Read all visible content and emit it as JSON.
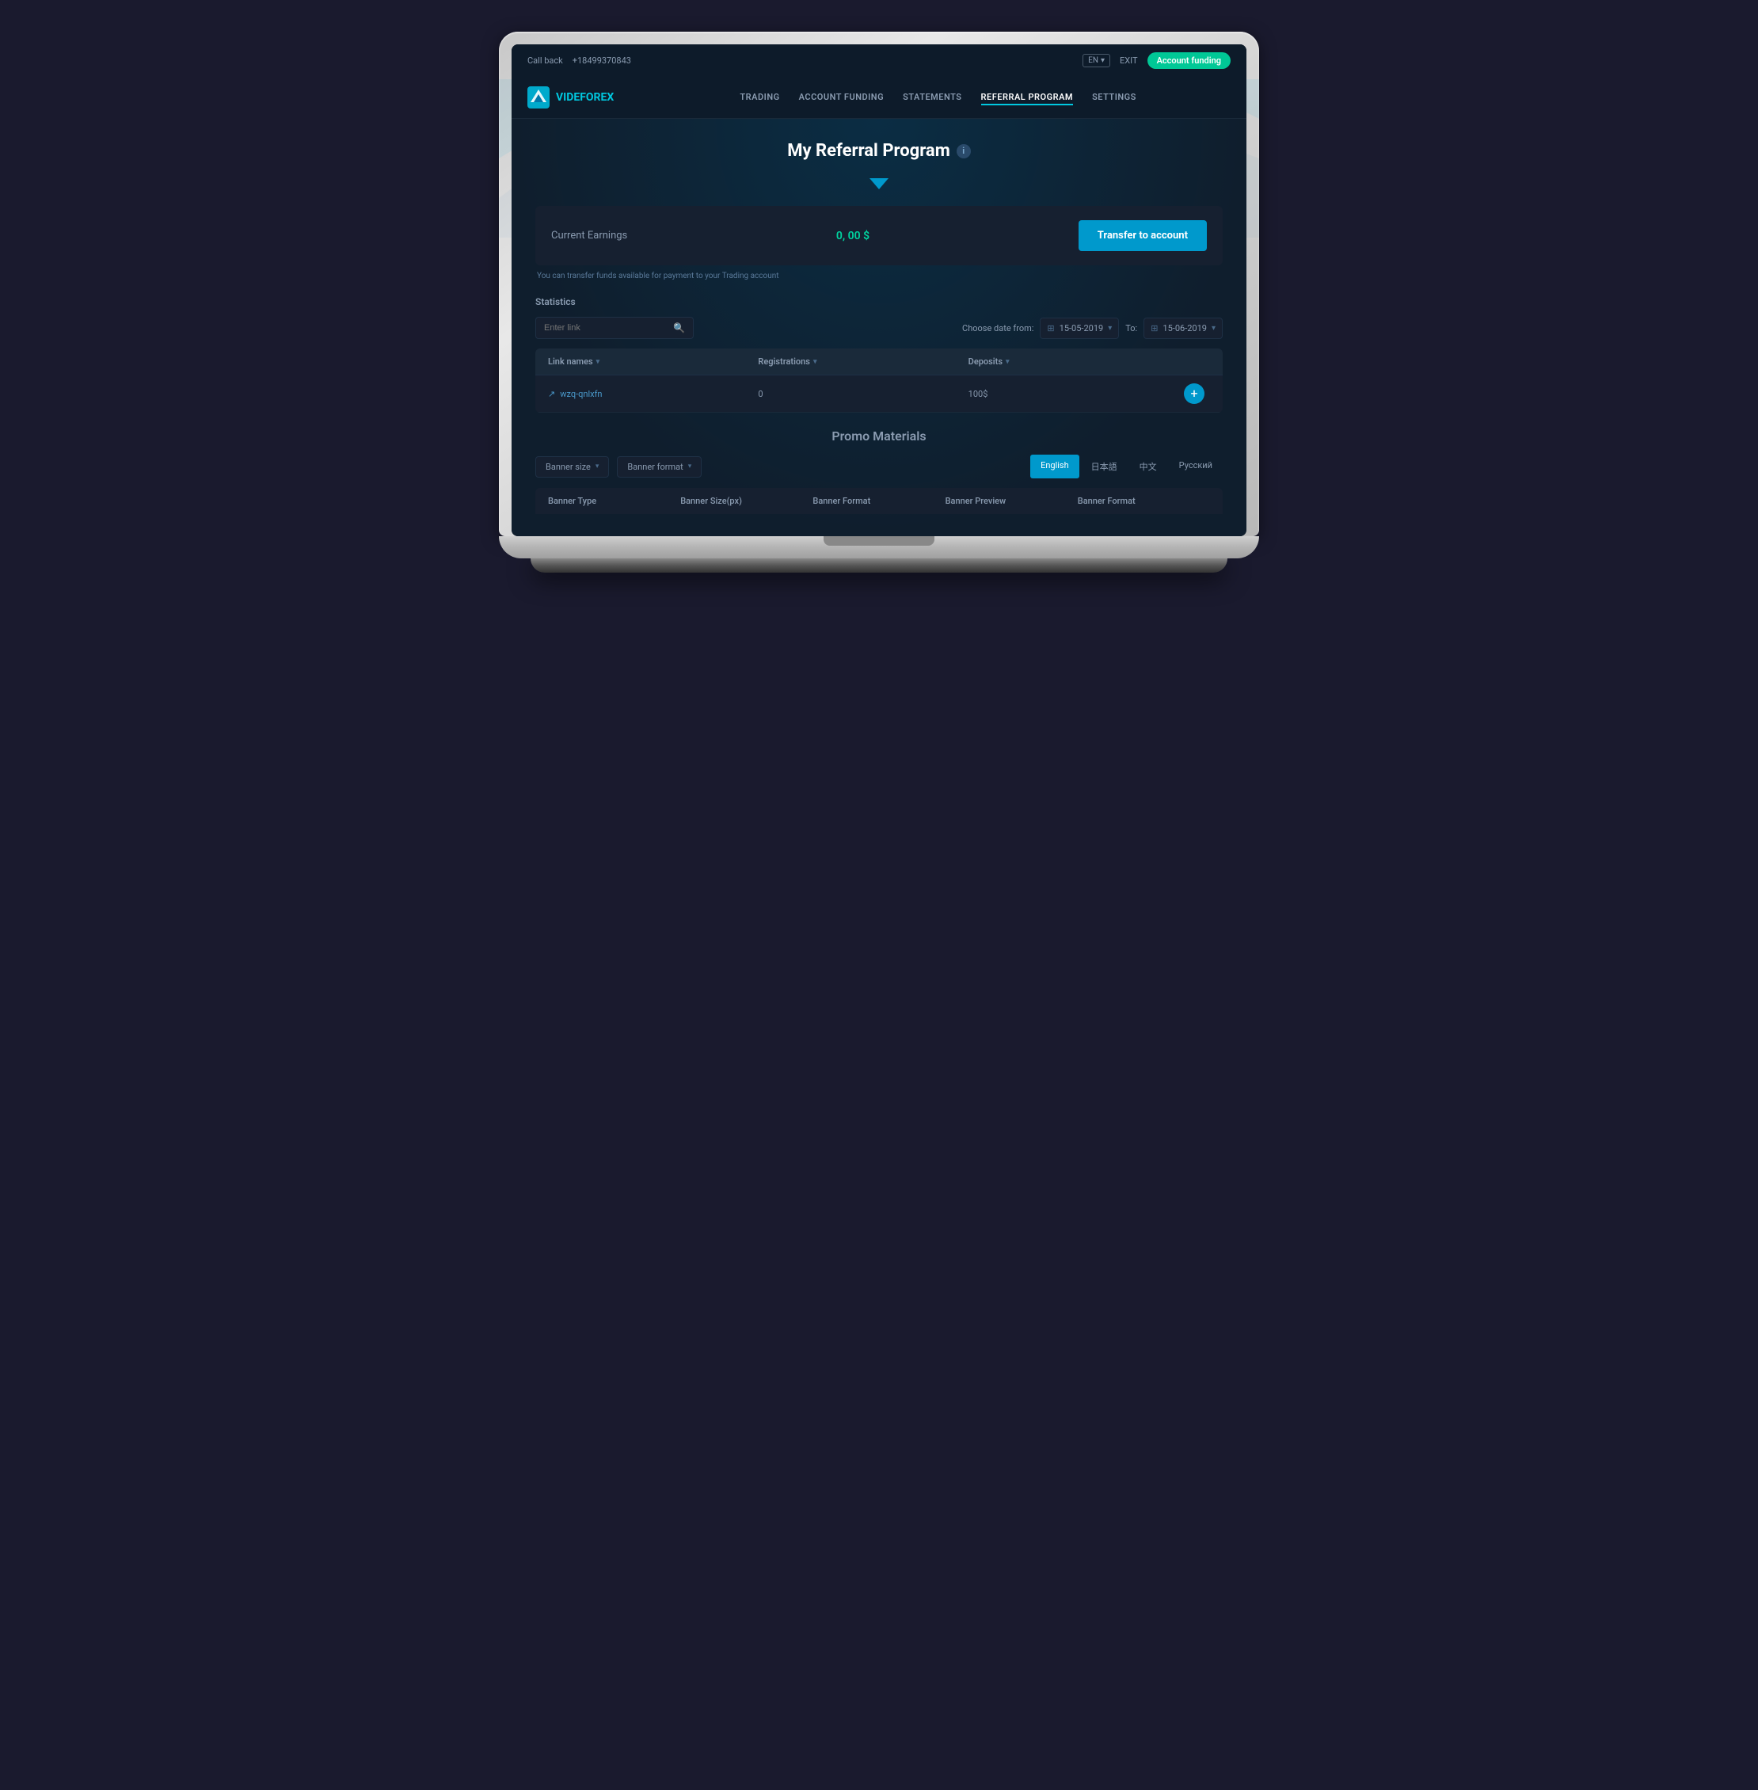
{
  "topbar": {
    "call_back_label": "Call back",
    "phone": "+18499370843",
    "lang": "EN",
    "lang_chevron": "▾",
    "exit_label": "EXIT",
    "account_funding_btn": "Account funding"
  },
  "nav": {
    "logo_text_vide": "VIDE",
    "logo_text_forex": "FOREX",
    "links": [
      {
        "label": "TRADING",
        "active": false
      },
      {
        "label": "ACCOUNT FUNDING",
        "active": false
      },
      {
        "label": "STATEMENTS",
        "active": false
      },
      {
        "label": "REFERRAL PROGRAM",
        "active": true
      },
      {
        "label": "SETTINGS",
        "active": false
      }
    ]
  },
  "page": {
    "title": "My Referral Program",
    "info_icon": "i",
    "chevron": "▼"
  },
  "earnings": {
    "label": "Current Earnings",
    "value": "0, 00 $",
    "transfer_btn": "Transfer to account",
    "hint": "You can transfer funds available for payment to your Trading account"
  },
  "statistics": {
    "section_title": "Statistics",
    "search_placeholder": "Enter link",
    "date_from_label": "Choose date from:",
    "date_from": "15-05-2019",
    "date_to_label": "To:",
    "date_to": "15-06-2019",
    "columns": [
      {
        "label": "Link names"
      },
      {
        "label": "Registrations"
      },
      {
        "label": "Deposits"
      }
    ],
    "rows": [
      {
        "link": "wzq-qnlxfn",
        "registrations": "0",
        "deposits": "100$"
      }
    ],
    "add_icon": "+"
  },
  "promo": {
    "title": "Promo Materials",
    "banner_size_label": "Banner size",
    "banner_format_label": "Banner format",
    "languages": [
      {
        "label": "English",
        "active": true
      },
      {
        "label": "日本語",
        "active": false
      },
      {
        "label": "中文",
        "active": false
      },
      {
        "label": "Русский",
        "active": false
      }
    ],
    "table_headers": [
      "Banner Type",
      "Banner Size(px)",
      "Banner Format",
      "Banner Preview",
      "Banner Format"
    ]
  }
}
